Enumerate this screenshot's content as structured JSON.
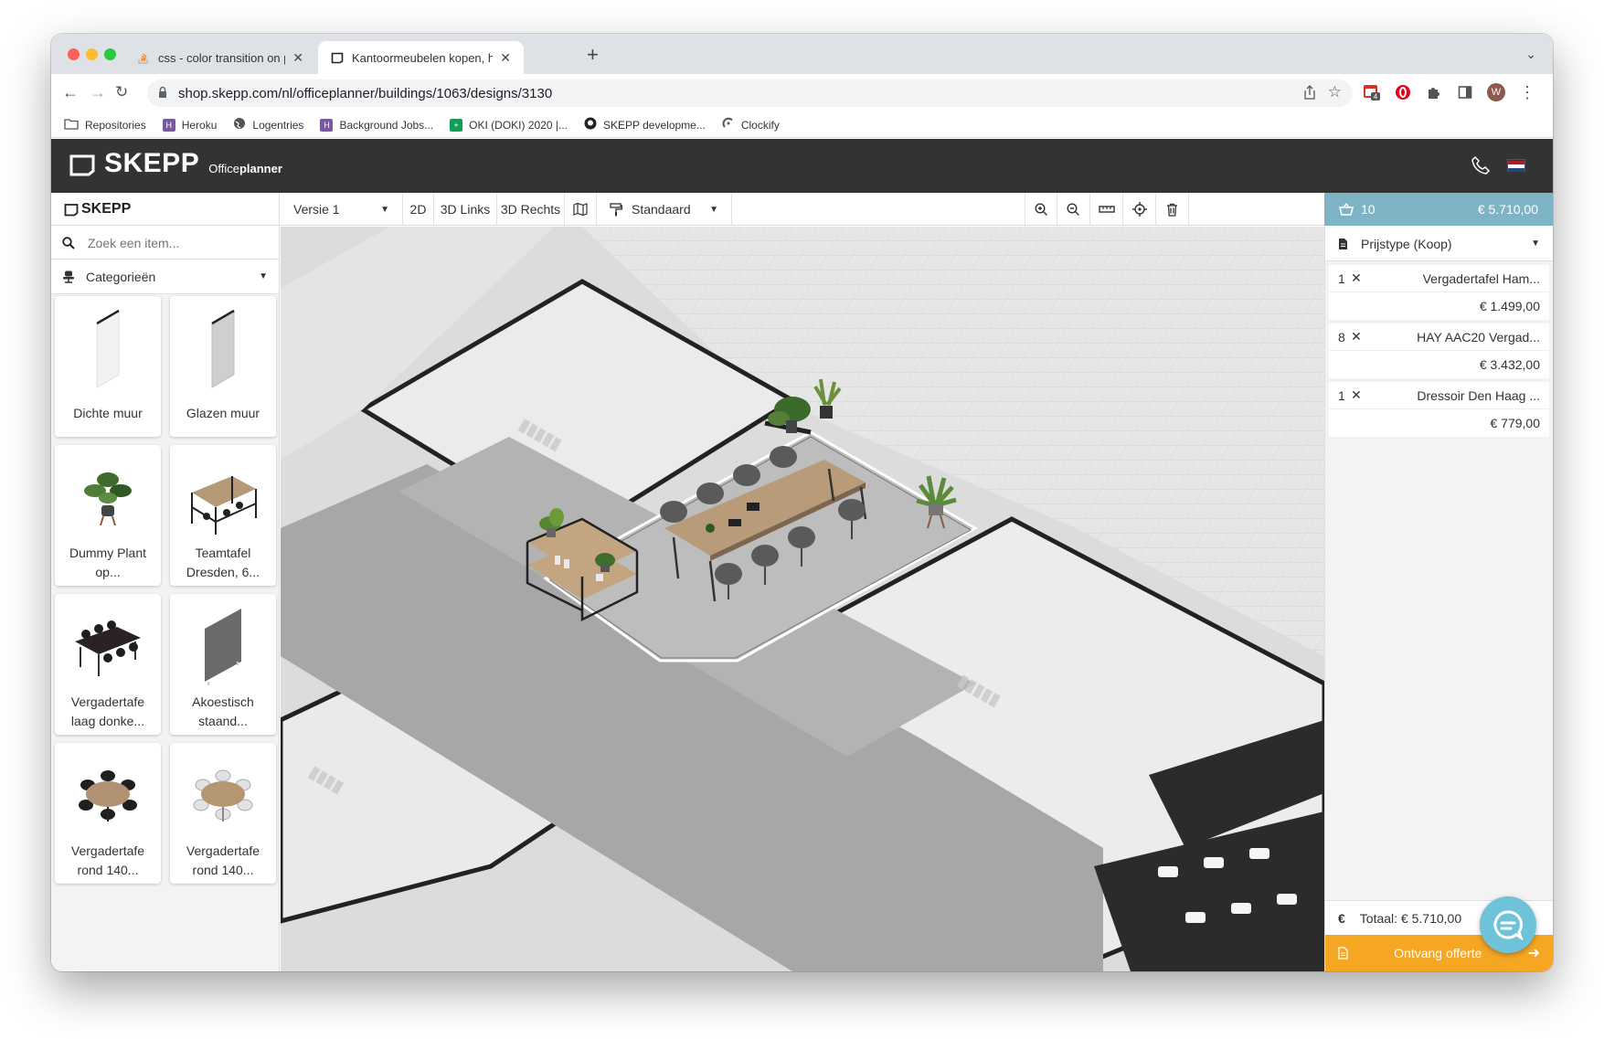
{
  "browser": {
    "tabs": [
      {
        "title": "css - color transition on page l",
        "active": false
      },
      {
        "title": "Kantoormeubelen kopen, huren",
        "active": true
      }
    ],
    "url": "shop.skepp.com/nl/officeplanner/buildings/1063/designs/3130",
    "extension_badge": "4",
    "avatar_initial": "W",
    "bookmarks": [
      {
        "label": "Repositories",
        "icon": "folder-icon"
      },
      {
        "label": "Heroku",
        "icon": "heroku-icon"
      },
      {
        "label": "Logentries",
        "icon": "globe-icon"
      },
      {
        "label": "Background Jobs...",
        "icon": "heroku-icon"
      },
      {
        "label": "OKI (DOKI) 2020 |...",
        "icon": "sheets-icon"
      },
      {
        "label": "SKEPP developme...",
        "icon": "github-icon"
      },
      {
        "label": "Clockify",
        "icon": "clockify-icon"
      }
    ]
  },
  "app": {
    "logo": "SKEPP",
    "subtitle_a": "Office",
    "subtitle_b": "planner"
  },
  "toolbar": {
    "left_logo": "SKEPP",
    "version": "Versie 1",
    "view_2d": "2D",
    "view_3d_left": "3D Links",
    "view_3d_right": "3D Rechts",
    "style": "Standaard",
    "cart_count": "10",
    "cart_total": "€ 5.710,00"
  },
  "left_panel": {
    "search_placeholder": "Zoek een item...",
    "categories_label": "Categorieën",
    "items": [
      {
        "name": "Dichte muur"
      },
      {
        "name": "Glazen muur"
      },
      {
        "name": "Dummy Plant op..."
      },
      {
        "name": "Teamtafel Dresden, 6..."
      },
      {
        "name": "Vergadertafe laag donke..."
      },
      {
        "name": "Akoestisch staand..."
      },
      {
        "name": "Vergadertafe rond 140..."
      },
      {
        "name": "Vergadertafe rond 140..."
      }
    ]
  },
  "right_panel": {
    "price_type": "Prijstype (Koop)",
    "lines": [
      {
        "qty": "1",
        "name": "Vergadertafel Ham...",
        "price": "€ 1.499,00"
      },
      {
        "qty": "8",
        "name": "HAY AAC20 Vergad...",
        "price": "€ 3.432,00"
      },
      {
        "qty": "1",
        "name": "Dressoir Den Haag ...",
        "price": "€ 779,00"
      }
    ],
    "total_label": "Totaal: € 5.710,00",
    "quote_label": "Ontvang offerte"
  },
  "colors": {
    "header": "#333333",
    "cart": "#7fb4c7",
    "quote": "#f5a623",
    "chat": "#6fc3d8"
  }
}
